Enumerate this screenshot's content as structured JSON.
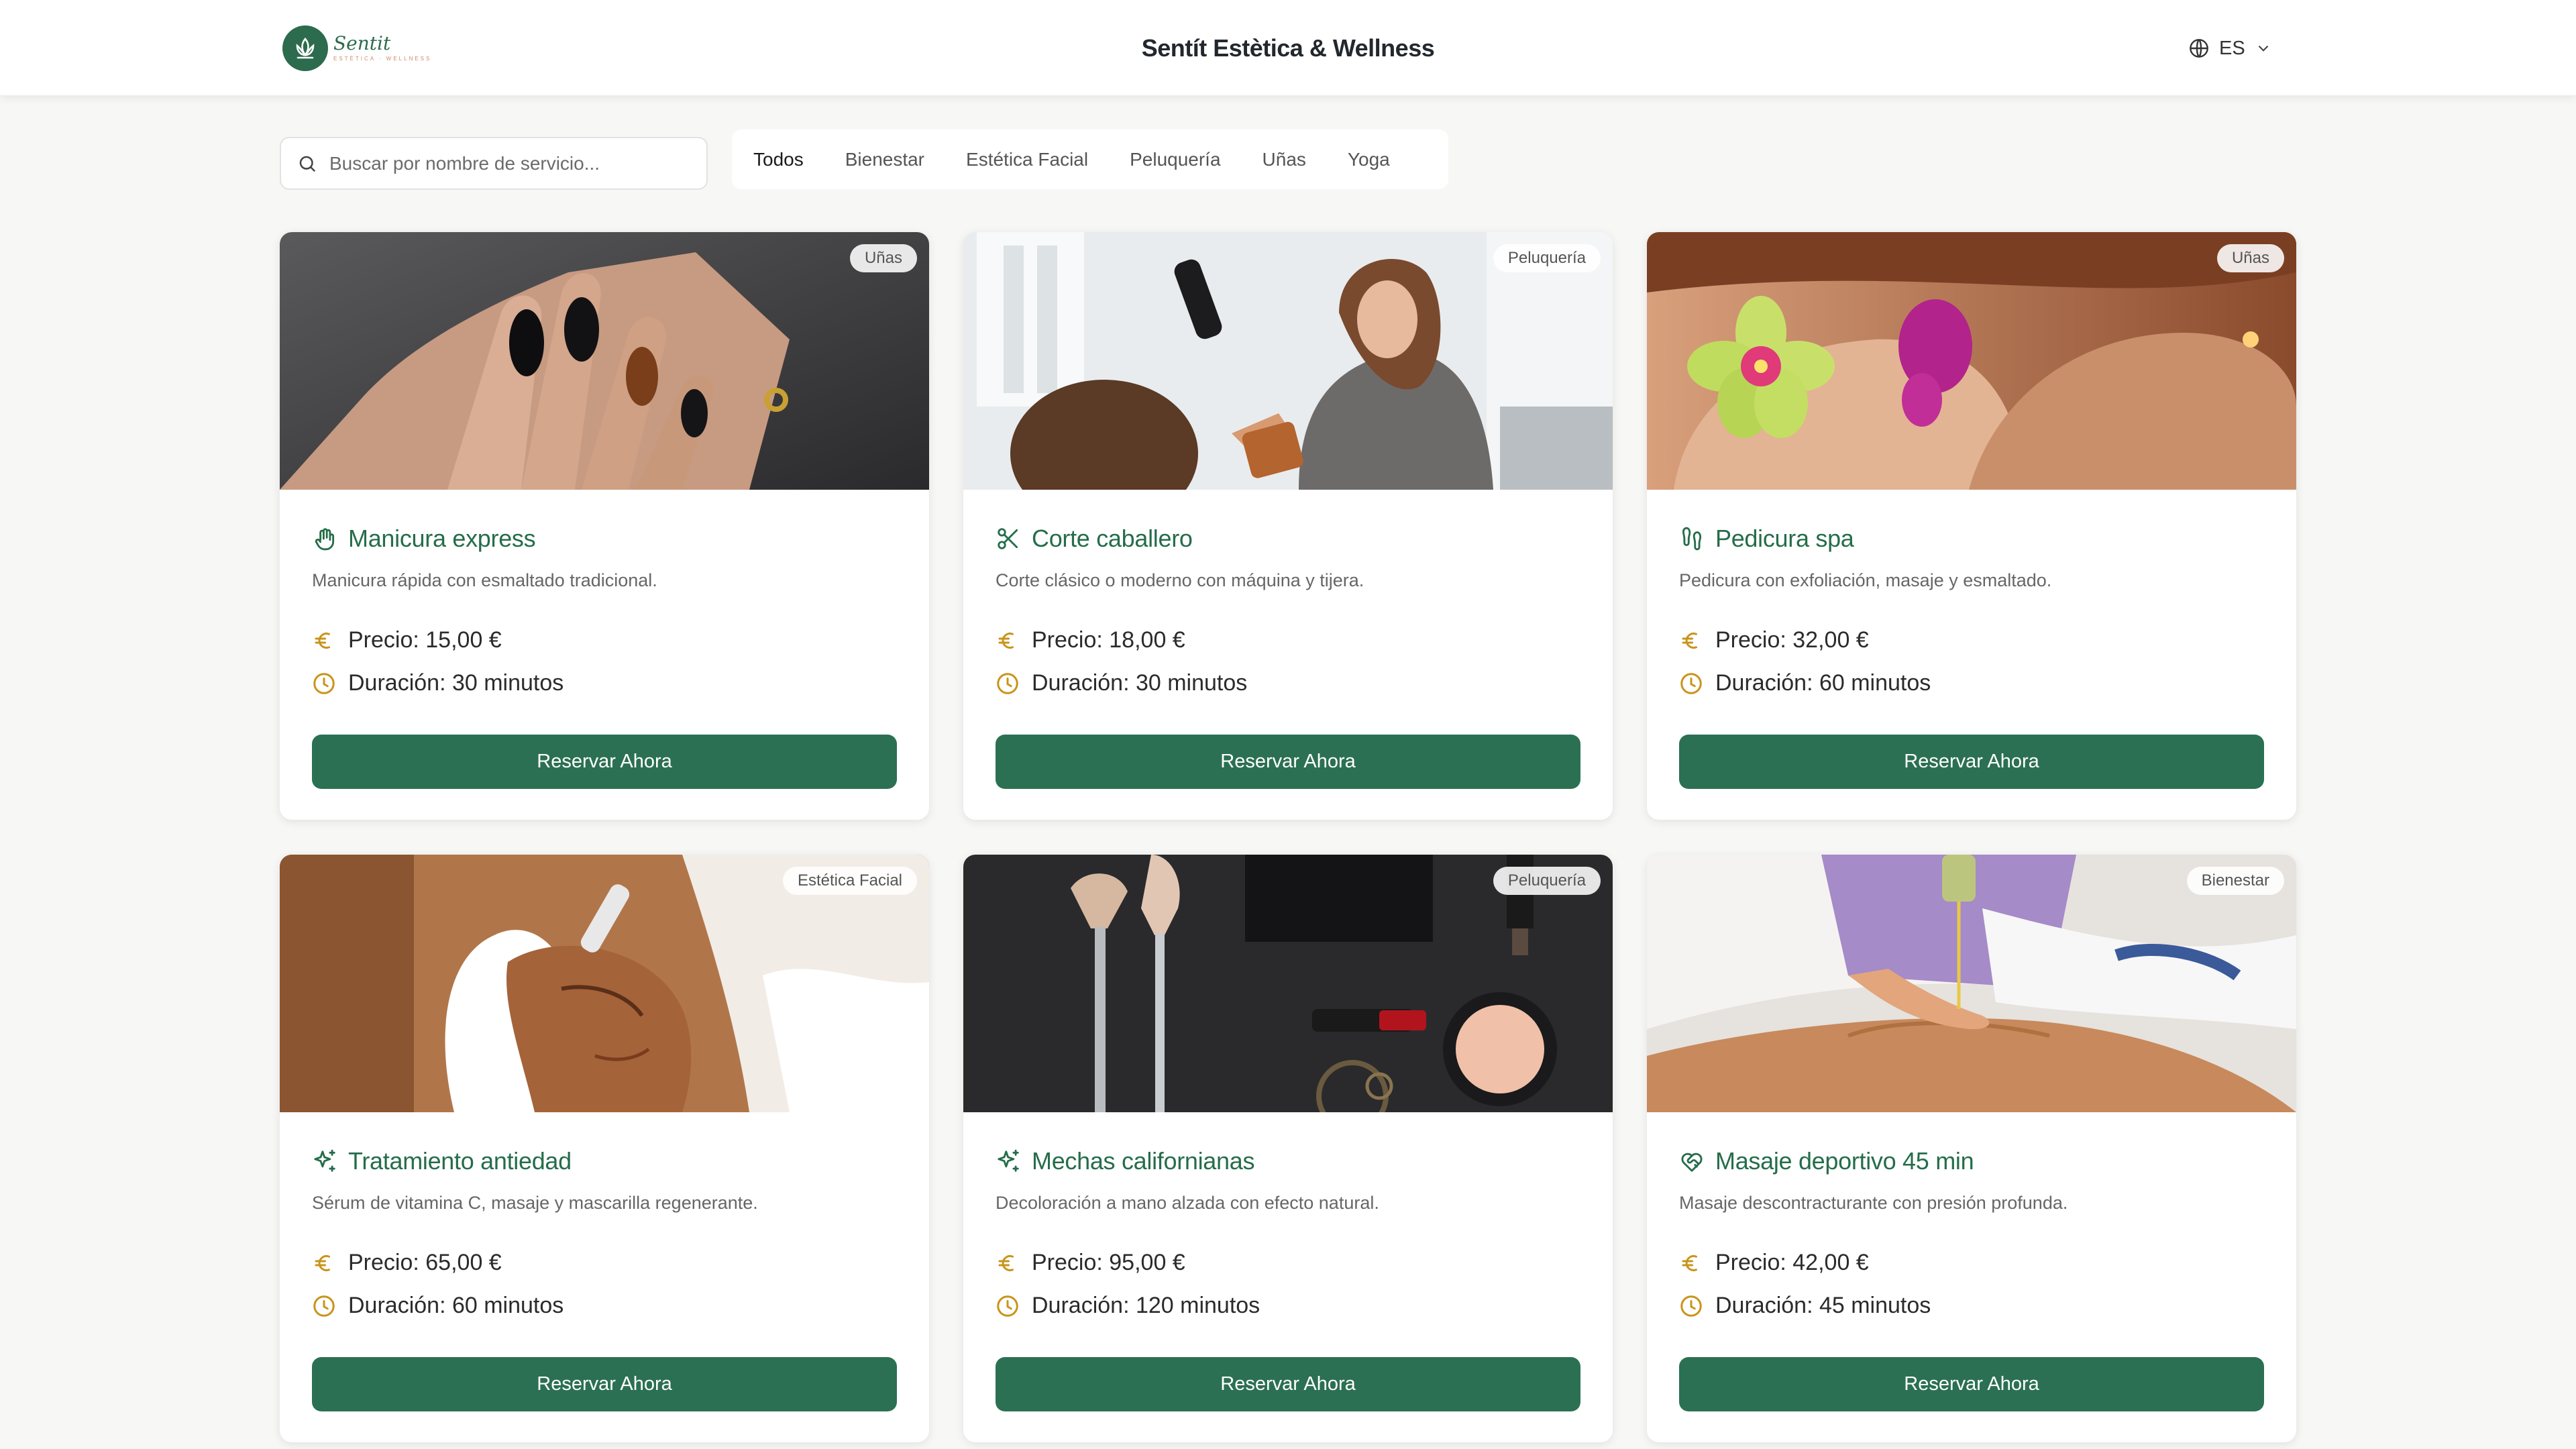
{
  "header": {
    "logo_name": "Sentit",
    "logo_sub": "ESTÈTICA · WELLNESS",
    "title": "Sentít Estètica & Wellness",
    "lang": "ES"
  },
  "search": {
    "placeholder": "Buscar por nombre de servicio..."
  },
  "tabs": [
    "Todos",
    "Bienestar",
    "Estética Facial",
    "Peluquería",
    "Uñas",
    "Yoga"
  ],
  "active_tab": "Todos",
  "colors": {
    "brand": "#2b7052",
    "accent_gold": "#c9941a",
    "title_green": "#256d4a"
  },
  "cards": [
    {
      "badge": "Uñas",
      "title": "Manicura express",
      "icon": "hand-icon",
      "desc": "Manicura rápida con esmaltado tradicional.",
      "price": "Precio: 15,00 €",
      "duration": "Duración: 30 minutos",
      "button": "Reservar Ahora"
    },
    {
      "badge": "Peluquería",
      "title": "Corte caballero",
      "icon": "scissors-icon",
      "desc": "Corte clásico o moderno con máquina y tijera.",
      "price": "Precio: 18,00 €",
      "duration": "Duración: 30 minutos",
      "button": "Reservar Ahora"
    },
    {
      "badge": "Uñas",
      "title": "Pedicura spa",
      "icon": "footprints-icon",
      "desc": "Pedicura con exfoliación, masaje y esmaltado.",
      "price": "Precio: 32,00 €",
      "duration": "Duración: 60 minutos",
      "button": "Reservar Ahora"
    },
    {
      "badge": "Estética Facial",
      "title": "Tratamiento antiedad",
      "icon": "sparkles-icon",
      "desc": "Sérum de vitamina C, masaje y mascarilla regenerante.",
      "price": "Precio: 65,00 €",
      "duration": "Duración: 60 minutos",
      "button": "Reservar Ahora"
    },
    {
      "badge": "Peluquería",
      "title": "Mechas californianas",
      "icon": "sparkles-icon",
      "desc": "Decoloración a mano alzada con efecto natural.",
      "price": "Precio: 95,00 €",
      "duration": "Duración: 120 minutos",
      "button": "Reservar Ahora"
    },
    {
      "badge": "Bienestar",
      "title": "Masaje deportivo 45 min",
      "icon": "heart-handshake-icon",
      "desc": "Masaje descontracturante con presión profunda.",
      "price": "Precio: 42,00 €",
      "duration": "Duración: 45 minutos",
      "button": "Reservar Ahora"
    }
  ]
}
